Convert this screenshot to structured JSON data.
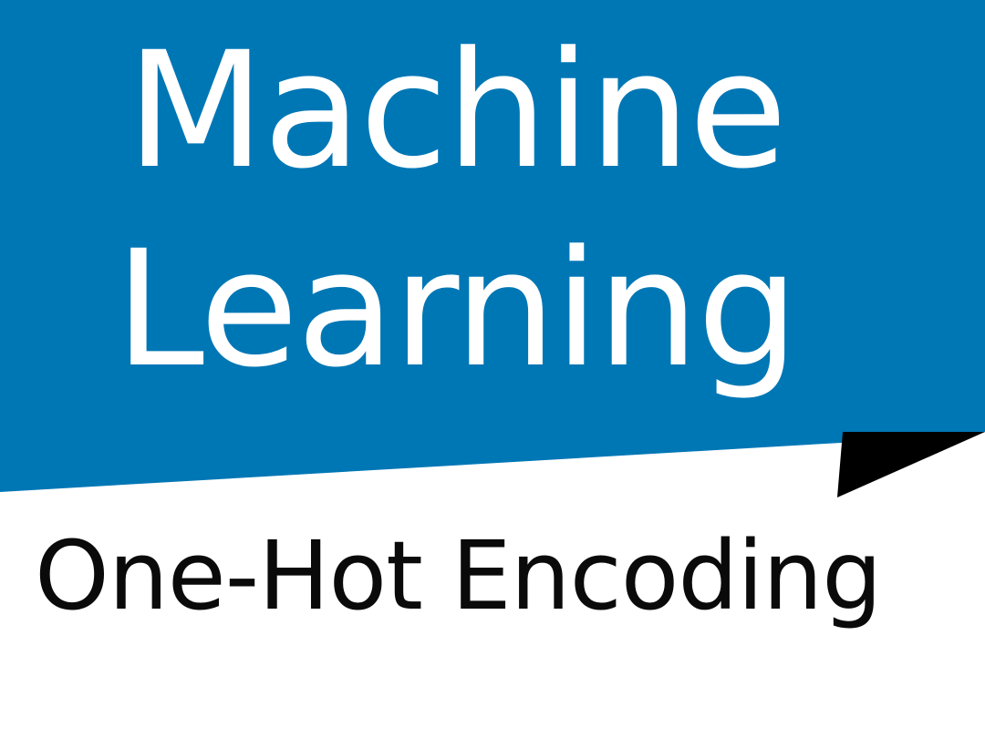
{
  "title": {
    "line1": "Machine",
    "line2": "Learning"
  },
  "subtitle": "One-Hot Encoding",
  "colors": {
    "banner": "#0077B5",
    "title_text": "#FFFFFF",
    "subtitle_text": "#0A0A0A",
    "accent_fold": "#000000",
    "background": "#FFFFFF"
  }
}
